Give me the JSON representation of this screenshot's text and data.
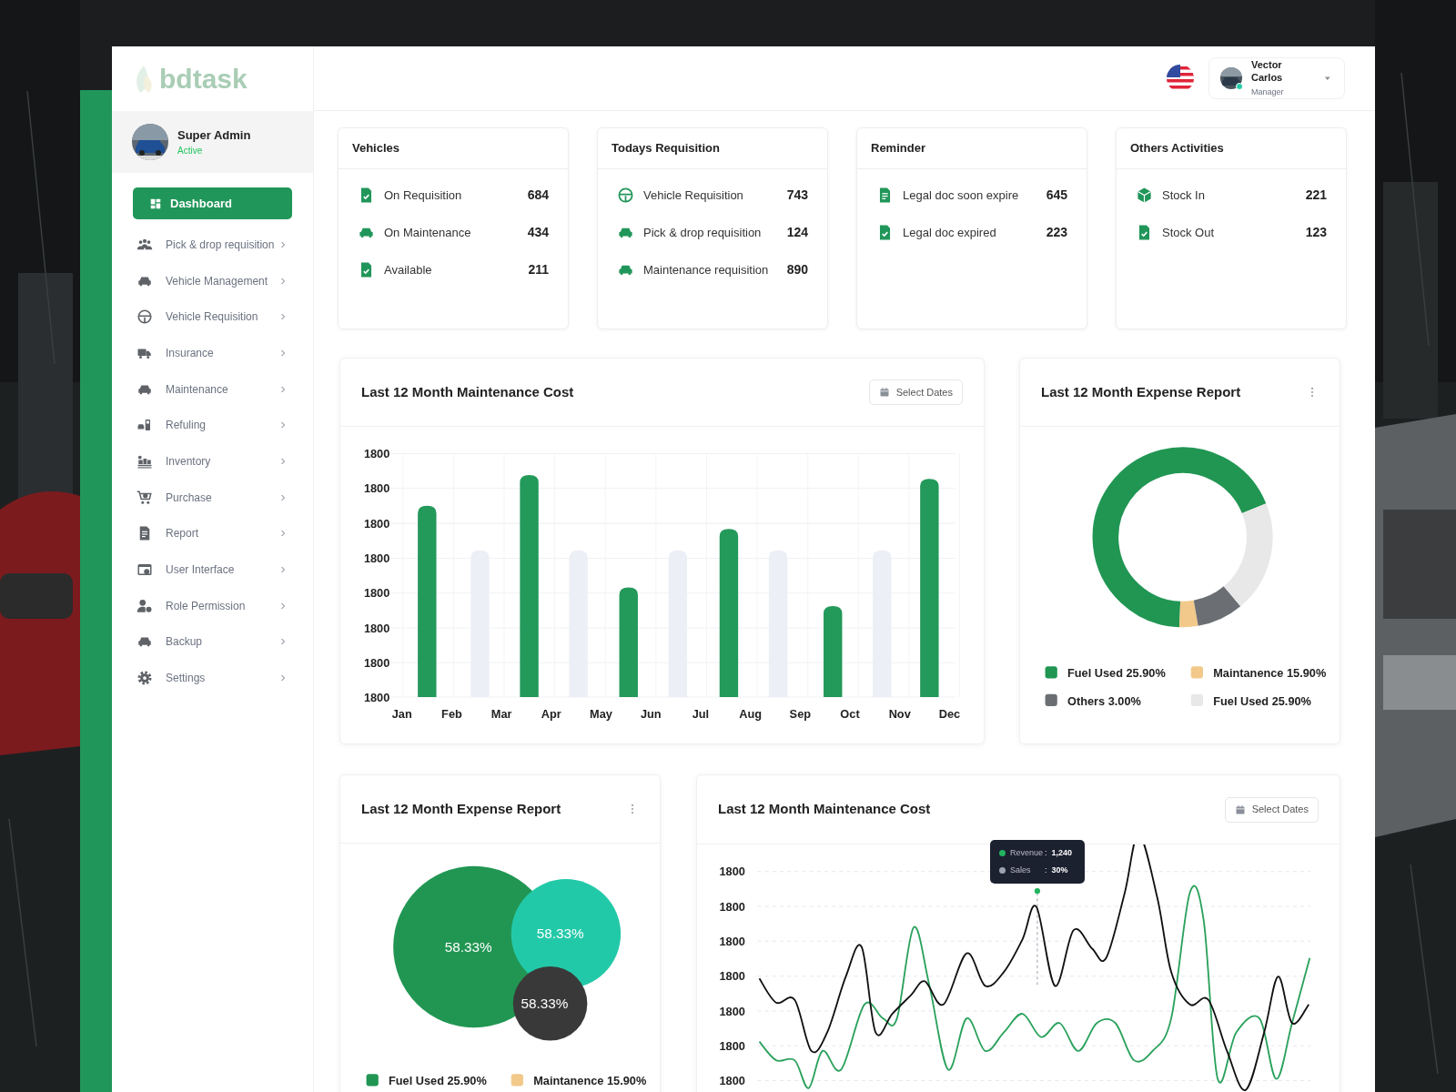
{
  "logo": {
    "text": "bdtask"
  },
  "profile": {
    "name": "Super Admin",
    "status": "Active"
  },
  "nav": [
    {
      "label": "Dashboard",
      "selected": true
    },
    {
      "label": "Pick & drop requisition",
      "selected": false
    },
    {
      "label": "Vehicle Management",
      "selected": false
    },
    {
      "label": "Vehicle Requisition",
      "selected": false
    },
    {
      "label": "Insurance",
      "selected": false
    },
    {
      "label": "Maintenance",
      "selected": false
    },
    {
      "label": "Refuling",
      "selected": false
    },
    {
      "label": "Inventory",
      "selected": false
    },
    {
      "label": "Purchase",
      "selected": false
    },
    {
      "label": "Report",
      "selected": false
    },
    {
      "label": "User Interface",
      "selected": false
    },
    {
      "label": "Role Permission",
      "selected": false
    },
    {
      "label": "Backup",
      "selected": false
    },
    {
      "label": "Settings",
      "selected": false
    }
  ],
  "header": {
    "user": {
      "name": "Vector Carlos",
      "role": "Manager",
      "online": true
    }
  },
  "stat_cards": [
    {
      "title": "Vehicles",
      "rows": [
        {
          "label": "On Requisition",
          "value": "684"
        },
        {
          "label": "On Maintenance",
          "value": "434"
        },
        {
          "label": "Available",
          "value": "211"
        }
      ]
    },
    {
      "title": "Todays Requisition",
      "rows": [
        {
          "label": "Vehicle Requisition",
          "value": "743"
        },
        {
          "label": "Pick & drop requisition",
          "value": "124"
        },
        {
          "label": "Maintenance requisition",
          "value": "890"
        }
      ]
    },
    {
      "title": "Reminder",
      "rows": [
        {
          "label": "Legal doc soon expire",
          "value": "645"
        },
        {
          "label": "Legal doc expired",
          "value": "223"
        }
      ]
    },
    {
      "title": "Others Activities",
      "rows": [
        {
          "label": "Stock In",
          "value": "221"
        },
        {
          "label": "Stock Out",
          "value": "123"
        }
      ]
    }
  ],
  "maintenance_bar_chart": {
    "title": "Last 12 Month Maintenance Cost",
    "button": "Select Dates",
    "y_labels": [
      "1800",
      "1800",
      "1800",
      "1800",
      "1800",
      "1800",
      "1800",
      "1800"
    ],
    "months": [
      "Jan",
      "Feb",
      "Mar",
      "Apr",
      "May",
      "Jun",
      "Jul",
      "Aug",
      "Sep",
      "Oct",
      "Nov",
      "Dec"
    ]
  },
  "expense_donut": {
    "title": "Last 12 Month Expense Report",
    "legend": [
      {
        "label": "Fuel Used 25.90%",
        "color": "#219653"
      },
      {
        "label": "Maintanence 15.90%",
        "color": "#f2c98a"
      },
      {
        "label": "Others 3.00%",
        "color": "#6b6f73"
      },
      {
        "label": "Fuel Used 25.90%",
        "color": "#e8e8e8"
      }
    ]
  },
  "expense_bubbles": {
    "title": "Last 12 Month Expense Report",
    "bubbles": [
      {
        "label": "58.33%",
        "color": "#219653"
      },
      {
        "label": "58.33%",
        "color": "#22c9a8"
      },
      {
        "label": "58.33%",
        "color": "#3a3939"
      }
    ],
    "legend": [
      {
        "label": "Fuel Used 25.90%",
        "color": "#219653"
      },
      {
        "label": "Maintanence 15.90%",
        "color": "#f2c98a"
      }
    ]
  },
  "maintenance_line_chart": {
    "title": "Last 12 Month Maintenance Cost",
    "button": "Select Dates",
    "y_labels": [
      "1800",
      "1800",
      "1800",
      "1800",
      "1800",
      "1800",
      "1800"
    ],
    "tooltip": {
      "separator": ":",
      "items": [
        {
          "label": "Revenue",
          "value": "1,240",
          "color": "#22b35e"
        },
        {
          "label": "Sales",
          "value": "30%",
          "color": "#9ca3af"
        }
      ]
    }
  }
}
